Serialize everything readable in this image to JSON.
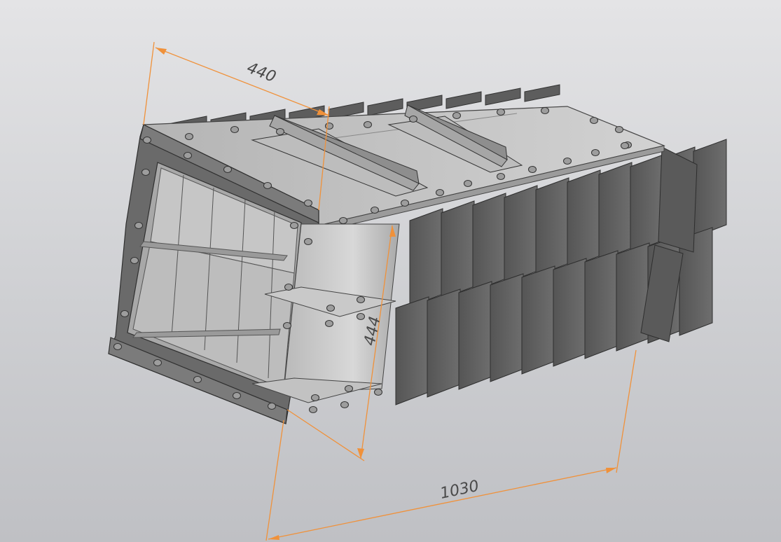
{
  "dimensions": {
    "width_label": "440",
    "height_label": "444",
    "length_label": "1030"
  },
  "colors": {
    "dimension_line": "#f0913a",
    "steel_dark": "#5c5c5c",
    "steel_mid": "#8a8a8a",
    "steel_light": "#c4c4c4",
    "bolt": "#9a9a9a"
  }
}
